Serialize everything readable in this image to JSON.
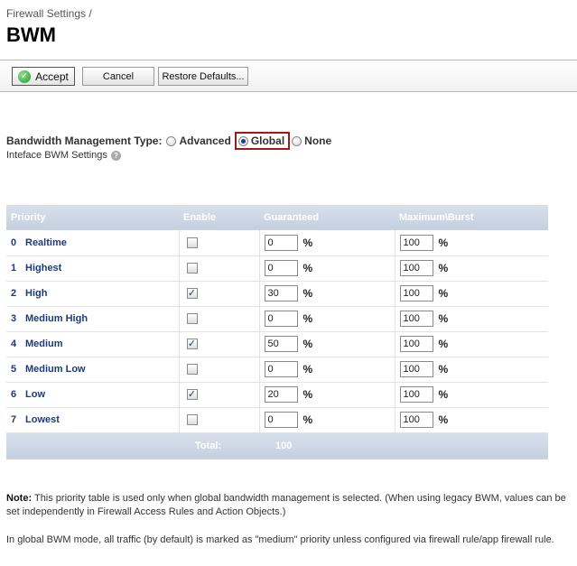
{
  "breadcrumb": "Firewall Settings /",
  "page_title": "BWM",
  "toolbar": {
    "accept_label": "Accept",
    "cancel_label": "Cancel",
    "restore_label": "Restore Defaults..."
  },
  "bwm_type": {
    "label": "Bandwidth Management Type:",
    "options": [
      "Advanced",
      "Global",
      "None"
    ],
    "selected": "Global"
  },
  "iface_label": "Inteface BWM Settings",
  "table": {
    "headers": [
      "Priority",
      "Enable",
      "Guaranteed",
      "Maximum\\Burst"
    ],
    "rows": [
      {
        "num": "0",
        "name": "Realtime",
        "enabled": false,
        "guaranteed": "0",
        "max": "100"
      },
      {
        "num": "1",
        "name": "Highest",
        "enabled": false,
        "guaranteed": "0",
        "max": "100"
      },
      {
        "num": "2",
        "name": "High",
        "enabled": true,
        "guaranteed": "30",
        "max": "100"
      },
      {
        "num": "3",
        "name": "Medium High",
        "enabled": false,
        "guaranteed": "0",
        "max": "100"
      },
      {
        "num": "4",
        "name": "Medium",
        "enabled": true,
        "guaranteed": "50",
        "max": "100"
      },
      {
        "num": "5",
        "name": "Medium Low",
        "enabled": false,
        "guaranteed": "0",
        "max": "100"
      },
      {
        "num": "6",
        "name": "Low",
        "enabled": true,
        "guaranteed": "20",
        "max": "100"
      },
      {
        "num": "7",
        "name": "Lowest",
        "enabled": false,
        "guaranteed": "0",
        "max": "100"
      }
    ],
    "pct_symbol": "%",
    "total_label": "Total:",
    "total_value": "100"
  },
  "note": {
    "bold": "Note:",
    "text": "This priority table is used only when global bandwidth management is selected. (When using legacy BWM, values can be set independently in Firewall Access Rules and Action Objects.)"
  },
  "global_note": "In global BWM mode, all traffic (by default) is marked as \"medium\" priority unless configured via firewall rule/app firewall rule.",
  "colors": {
    "header_bg": "#c8d2e2",
    "priority_text": "#1e3a77",
    "highlight_border": "#a01818"
  },
  "icons": {
    "accept": "check-circle-icon",
    "help": "help-icon"
  }
}
